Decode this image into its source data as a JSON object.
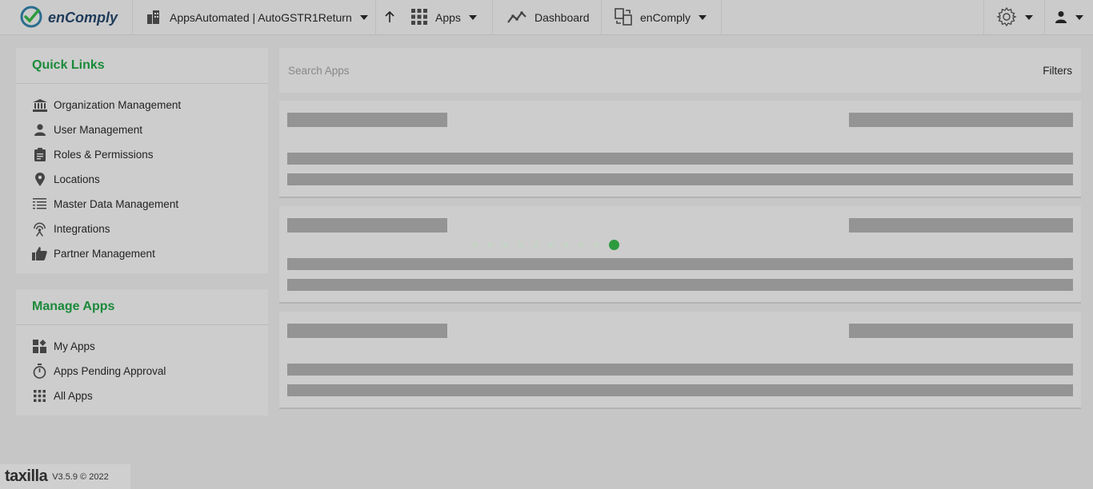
{
  "brand": {
    "name": "enComply",
    "icon": "check-circle-logo-icon"
  },
  "topbar": {
    "org_label": "AppsAutomated | AutoGSTR1Return",
    "apps_label": "Apps",
    "dashboard_label": "Dashboard",
    "product_label": "enComply"
  },
  "quick_links": {
    "title": "Quick Links",
    "items": [
      {
        "label": "Organization Management",
        "icon": "bank-icon"
      },
      {
        "label": "User Management",
        "icon": "person-icon"
      },
      {
        "label": "Roles & Permissions",
        "icon": "clipboard-icon"
      },
      {
        "label": "Locations",
        "icon": "map-pin-icon"
      },
      {
        "label": "Master Data Management",
        "icon": "data-table-icon"
      },
      {
        "label": "Integrations",
        "icon": "antenna-icon"
      },
      {
        "label": "Partner Management",
        "icon": "thumbs-up-icon"
      }
    ]
  },
  "manage_apps": {
    "title": "Manage Apps",
    "items": [
      {
        "label": "My Apps",
        "icon": "widgets-icon"
      },
      {
        "label": "Apps Pending Approval",
        "icon": "stopwatch-icon"
      },
      {
        "label": "All Apps",
        "icon": "grid-icon"
      }
    ]
  },
  "search": {
    "placeholder": "Search Apps",
    "filters_label": "Filters"
  },
  "footer": {
    "logo": "taxilla",
    "version": "V3.5.9 © 2022"
  },
  "colors": {
    "accent": "#1a8a3a",
    "loader": "#2e9a3e",
    "skeleton": "#949494",
    "background": "#c6c6c6"
  }
}
